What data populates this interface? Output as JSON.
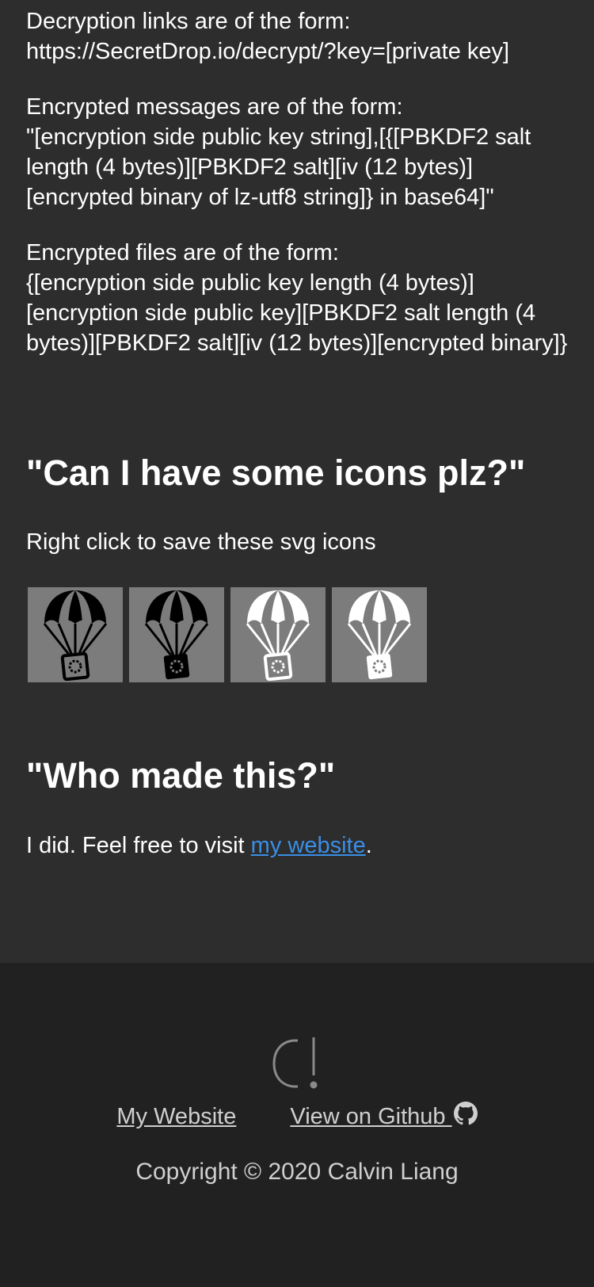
{
  "faq": {
    "decryption_links": {
      "line1": "Decryption links are of the form:",
      "line2": "https://SecretDrop.io/decrypt/?key=[private key]"
    },
    "encrypted_messages": {
      "line1": "Encrypted messages are of the form:",
      "line2": "\"[encryption side public key string],[{[PBKDF2 salt length (4 bytes)][PBKDF2 salt][iv (12 bytes)][encrypted binary of lz-utf8 string]} in base64]\""
    },
    "encrypted_files": {
      "line1": "Encrypted files are of the form:",
      "line2": "{[encryption side public key length (4 bytes)][encryption side public key][PBKDF2 salt length (4 bytes)][PBKDF2 salt][iv (12 bytes)][encrypted binary]}"
    }
  },
  "icons_section": {
    "heading": "\"Can I have some icons plz?\"",
    "text": "Right click to save these svg icons",
    "icons": [
      {
        "name": "parachute-black-outline-icon",
        "fill": "#000000",
        "box": "outline"
      },
      {
        "name": "parachute-black-solid-icon",
        "fill": "#000000",
        "box": "solid"
      },
      {
        "name": "parachute-white-outline-icon",
        "fill": "#ffffff",
        "box": "outline"
      },
      {
        "name": "parachute-white-solid-icon",
        "fill": "#ffffff",
        "box": "solid"
      }
    ]
  },
  "who_section": {
    "heading": "\"Who made this?\"",
    "text_before": "I did. Feel free to visit ",
    "link_text": "my website",
    "text_after": "."
  },
  "footer": {
    "logo_icon": "c-exclamation-logo-icon",
    "links": {
      "website": "My Website",
      "github": "View on Github "
    },
    "github_icon": "github-icon",
    "copyright": "Copyright © 2020 Calvin Liang"
  },
  "colors": {
    "page_background": "#2d2d2d",
    "footer_background": "#212121",
    "icon_box_background": "#7c7c7c",
    "link_blue": "#3a8ee6",
    "footer_text": "#cfcfcf"
  }
}
